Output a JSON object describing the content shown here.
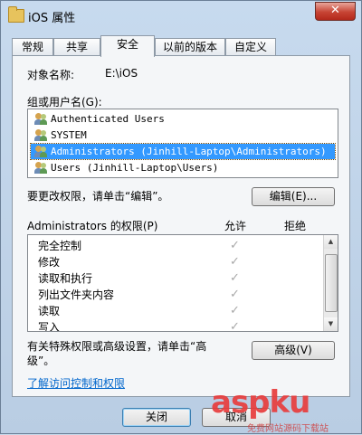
{
  "window": {
    "title": "iOS 属性",
    "close_glyph": "✕"
  },
  "tabs": [
    {
      "label": "常规"
    },
    {
      "label": "共享"
    },
    {
      "label": "安全"
    },
    {
      "label": "以前的版本"
    },
    {
      "label": "自定义"
    }
  ],
  "security": {
    "object_label": "对象名称:",
    "object_value": "E:\\iOS",
    "group_label": "组或用户名(G):",
    "users": [
      {
        "name": "Authenticated Users"
      },
      {
        "name": "SYSTEM"
      },
      {
        "name": "Administrators (Jinhill-Laptop\\Administrators)",
        "selected": true
      },
      {
        "name": "Users (Jinhill-Laptop\\Users)"
      }
    ],
    "edit_hint": "要更改权限，请单击“编辑”。",
    "edit_button": "编辑(E)...",
    "perm_title": "Administrators 的权限(P)",
    "allow_header": "允许",
    "deny_header": "拒绝",
    "permissions": [
      {
        "name": "完全控制",
        "allow": true
      },
      {
        "name": "修改",
        "allow": true
      },
      {
        "name": "读取和执行",
        "allow": true
      },
      {
        "name": "列出文件夹内容",
        "allow": true
      },
      {
        "name": "读取",
        "allow": true
      },
      {
        "name": "写入",
        "allow": true
      }
    ],
    "advanced_hint": "有关特殊权限或高级设置，请单击“高级”。",
    "advanced_button": "高级(V)",
    "learn_link": "了解访问控制和权限"
  },
  "footer": {
    "close_button": "关闭",
    "cancel_button": "取消"
  },
  "watermark": {
    "text": "aspku",
    "subtext": "免费网站源码下载站",
    "color": "#e83d3d"
  }
}
